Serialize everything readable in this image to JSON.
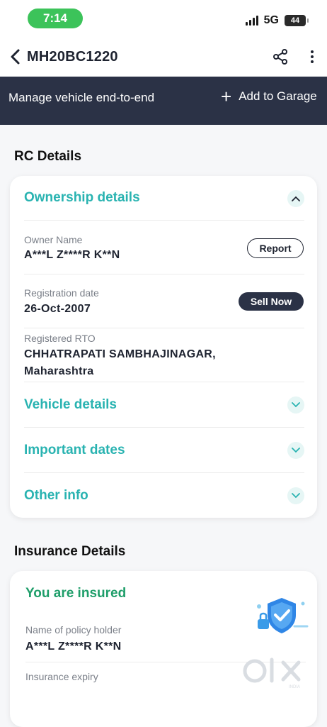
{
  "status_bar": {
    "time": "7:14",
    "network": "5G",
    "battery": "44",
    "time_pill_color": "#3cc35a"
  },
  "app_bar": {
    "title": "MH20BC1220",
    "back_icon": "chevron-left-icon",
    "share_icon": "share-icon",
    "more_icon": "more-vertical-icon"
  },
  "banner": {
    "text": "Manage vehicle end-to-end",
    "add_garage_label": "Add to Garage",
    "background": "#2b3246"
  },
  "rc": {
    "section_title": "RC Details",
    "ownership": {
      "heading": "Ownership details",
      "owner_name_label": "Owner Name",
      "owner_name_value": "A***L Z****R K**N",
      "report_label": "Report",
      "registration_date_label": "Registration date",
      "registration_date_value": "26-Oct-2007",
      "sell_now_label": "Sell Now",
      "rto_label": "Registered RTO",
      "rto_value_line1": "CHHATRAPATI SAMBHAJINAGAR,",
      "rto_value_line2": "Maharashtra"
    },
    "vehicle_details": "Vehicle details",
    "important_dates": "Important dates",
    "other_info": "Other info",
    "accent_color": "#29b3b1"
  },
  "insurance": {
    "section_title": "Insurance Details",
    "status": "You are insured",
    "policy_holder_label": "Name of policy holder",
    "policy_holder_value": "A***L Z****R K**N",
    "expiry_label": "Insurance expiry",
    "status_color": "#1f9e6a"
  },
  "watermark": {
    "brand": "OLX",
    "sub": "INDIA"
  }
}
